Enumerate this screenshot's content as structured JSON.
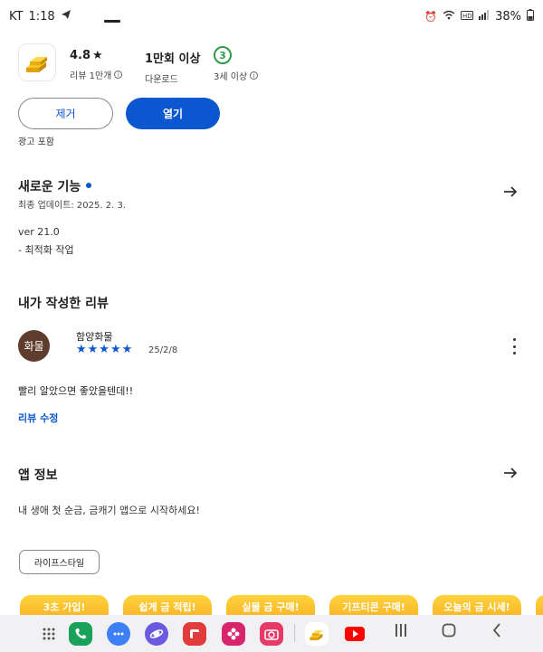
{
  "status_bar": {
    "carrier": "KT",
    "time": "1:18",
    "battery": "38%"
  },
  "app": {
    "rating": "4.8",
    "rating_star": "★",
    "reviews_label": "리뷰 1만개",
    "downloads": "1만회 이상",
    "downloads_label": "다운로드",
    "age_rating": "3",
    "age_label": "3세 이상",
    "remove_label": "제거",
    "open_label": "열기",
    "ads_note": "광고 포함"
  },
  "whats_new": {
    "title": "새로운 기능",
    "updated": "최종 업데이트: 2025. 2. 3.",
    "version": "ver 21.0",
    "notes": "- 최적화 작업"
  },
  "my_review": {
    "title": "내가 작성한 리뷰",
    "avatar_text": "화물",
    "reviewer": "함양화물",
    "stars": "★★★★★",
    "rating_value": 5,
    "date": "25/2/8",
    "text": "빨리 알았으면 좋았을텐데!!",
    "edit_label": "리뷰 수정"
  },
  "app_info": {
    "title": "앱 정보",
    "description": "내 생애 첫 순금, 금캐기 앱으로 시작하세요!",
    "category_chip": "라이프스타일"
  },
  "promos": [
    "3초 가입!",
    "쉽게 금 적립!",
    "실물 금 구매!",
    "기프티콘 구매!",
    "오늘의 금 시세!"
  ],
  "nav": {
    "apps": [
      "grid-icon",
      "phone-icon",
      "messages-icon",
      "internet-icon",
      "flipboard-icon",
      "gallery-icon",
      "camera-icon",
      "gold-app-icon",
      "youtube-icon"
    ]
  },
  "colors": {
    "accent": "#0b57d0",
    "age_green": "#2e9b48",
    "avatar_brown": "#5e3d2e",
    "promo_gold": "#f6a81c"
  }
}
